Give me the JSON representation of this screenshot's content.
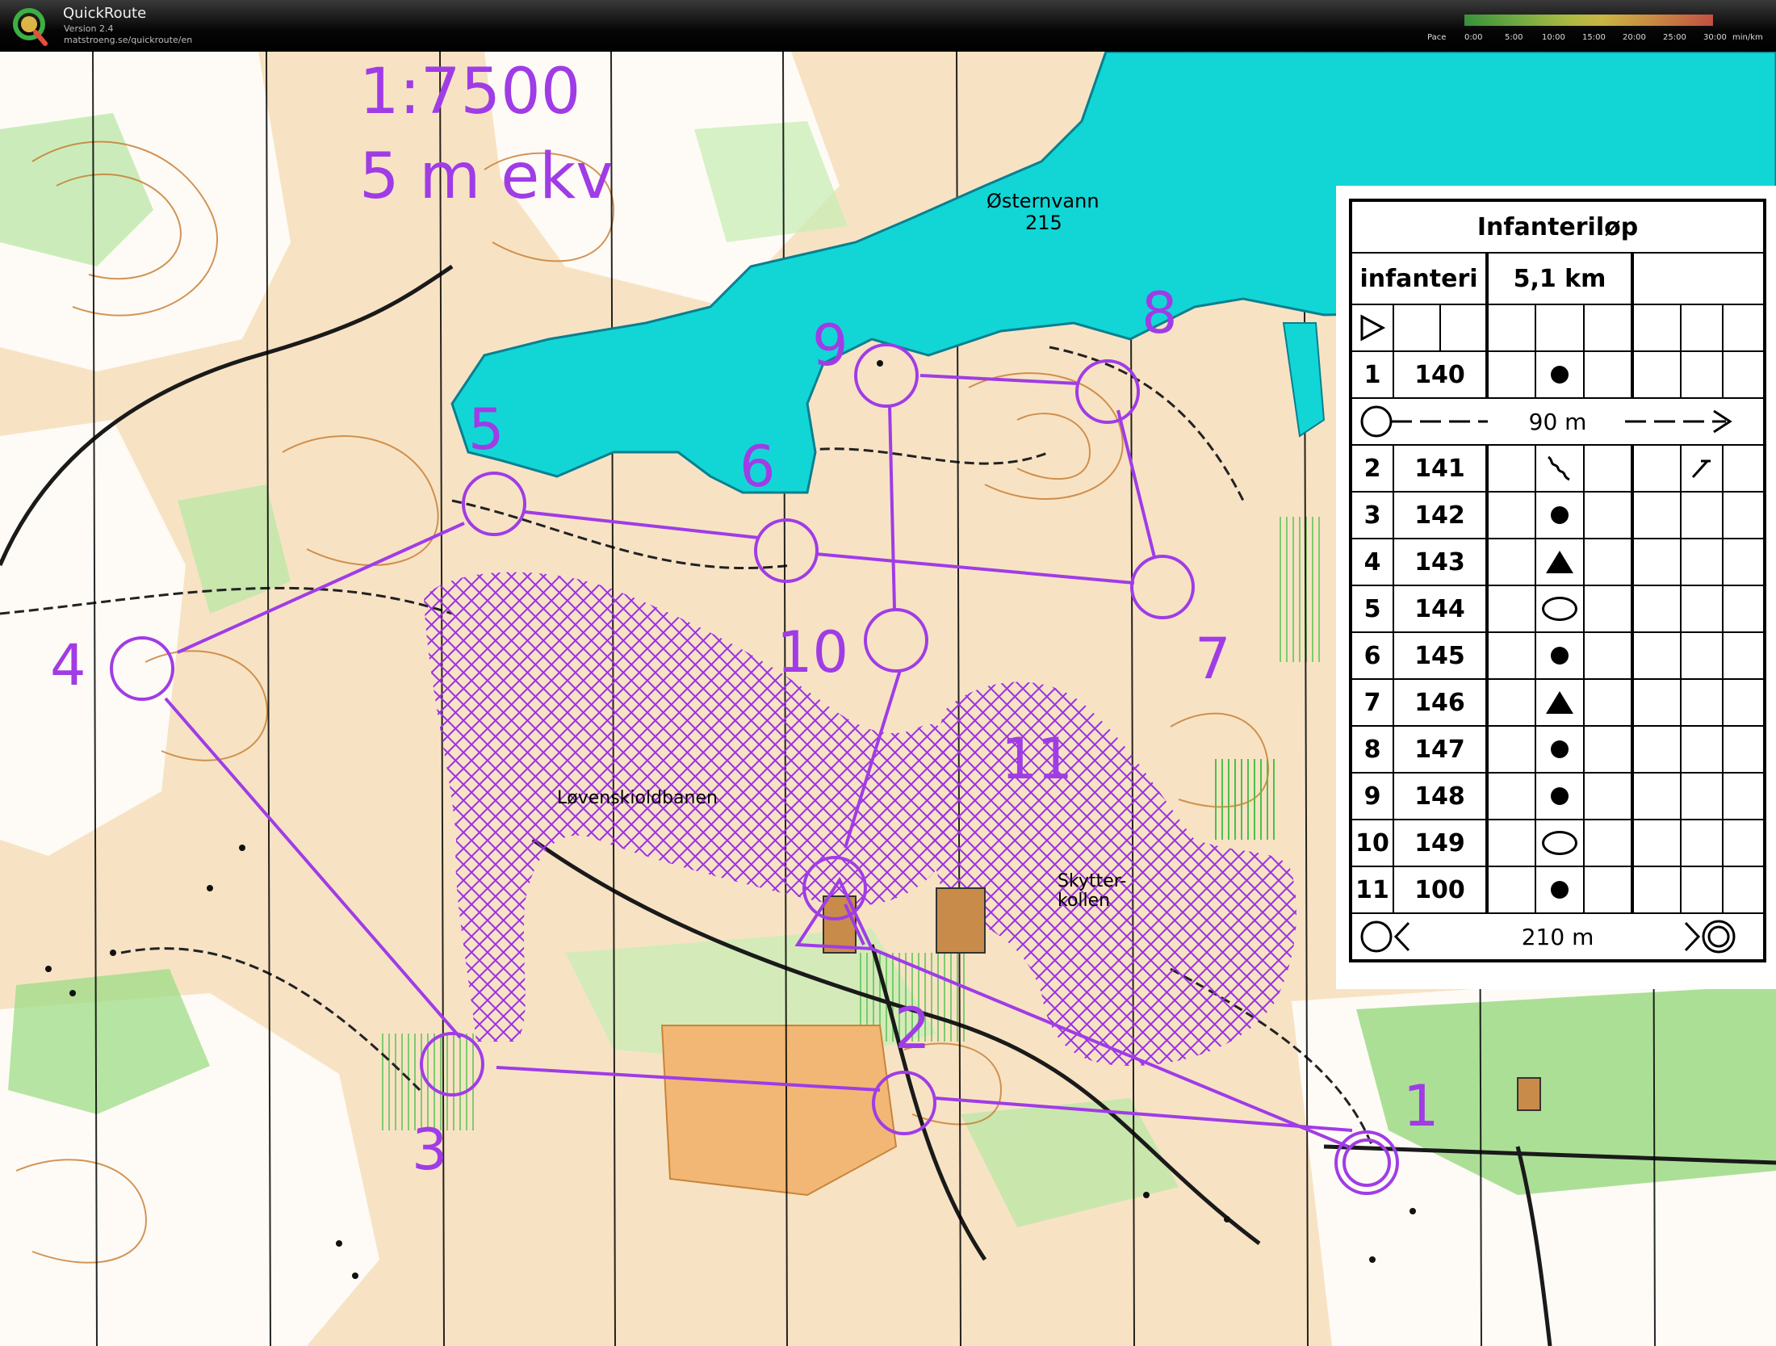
{
  "app": {
    "title": "QuickRoute",
    "version": "Version 2.4",
    "url": "matstroeng.se/quickroute/en"
  },
  "pace_legend": {
    "label": "Pace",
    "ticks": [
      "0:00",
      "5:00",
      "10:00",
      "15:00",
      "20:00",
      "25:00",
      "30:00"
    ],
    "unit": "min/km"
  },
  "map": {
    "scale": "1:7500",
    "contour": "5 m ekv",
    "lake_name": "Østernvann",
    "lake_height": "215",
    "place_1": "Løvenskioldbanen",
    "place_2": "Skytter-",
    "place_3": "kollen",
    "course_color": "#a03ce6",
    "lake_color": "#12d6d6"
  },
  "controls": [
    "1",
    "2",
    "3",
    "4",
    "5",
    "6",
    "7",
    "8",
    "9",
    "10",
    "11"
  ],
  "description": {
    "title": "Infanteriløp",
    "class_name": "infanteri",
    "length": "5,1 km",
    "start_distance": "90 m",
    "finish_distance": "210 m",
    "rows": [
      {
        "num": "1",
        "code": "140",
        "symbol": "dot"
      },
      {
        "num": "2",
        "code": "141",
        "symbol": "ditch"
      },
      {
        "num": "3",
        "code": "142",
        "symbol": "dot"
      },
      {
        "num": "4",
        "code": "143",
        "symbol": "triangle"
      },
      {
        "num": "5",
        "code": "144",
        "symbol": "oval"
      },
      {
        "num": "6",
        "code": "145",
        "symbol": "dot"
      },
      {
        "num": "7",
        "code": "146",
        "symbol": "triangle"
      },
      {
        "num": "8",
        "code": "147",
        "symbol": "dot"
      },
      {
        "num": "9",
        "code": "148",
        "symbol": "dot"
      },
      {
        "num": "10",
        "code": "149",
        "symbol": "oval"
      },
      {
        "num": "11",
        "code": "100",
        "symbol": "dot"
      }
    ]
  }
}
